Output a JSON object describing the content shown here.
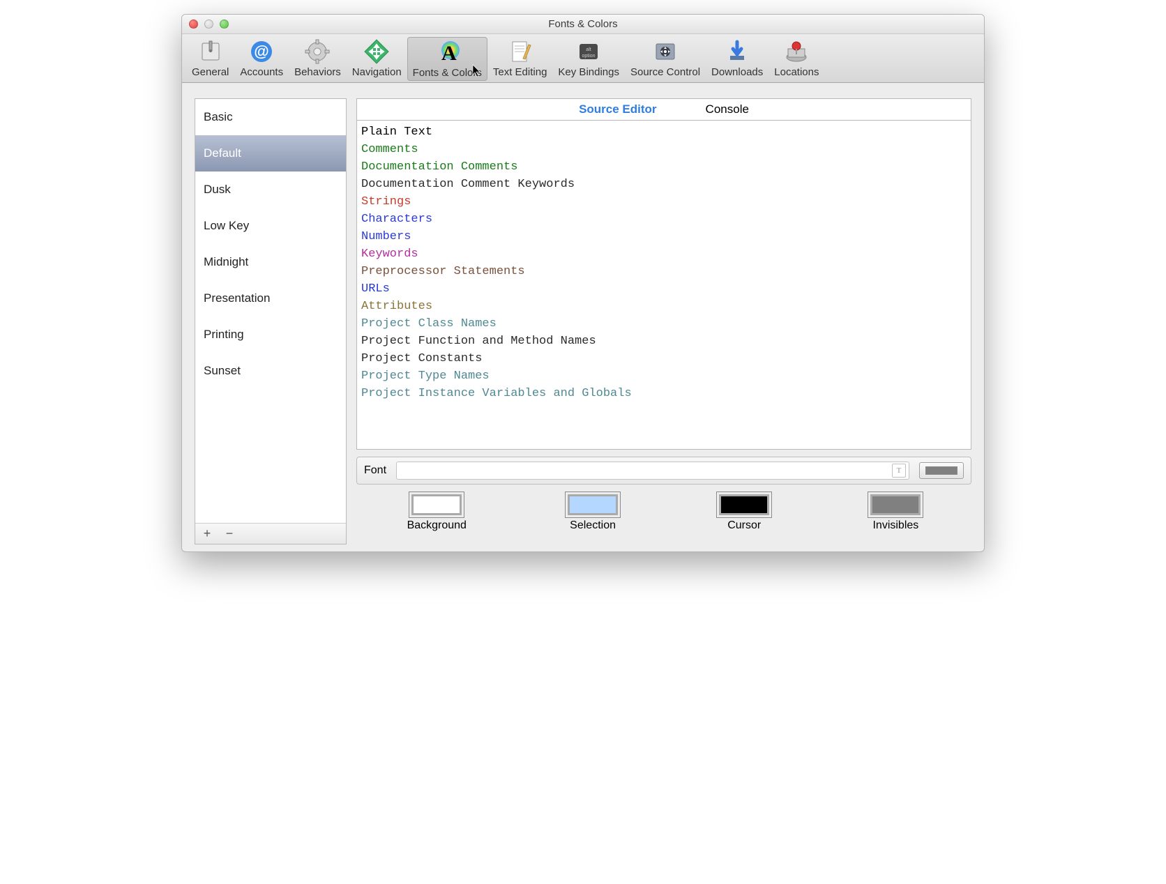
{
  "window": {
    "title": "Fonts & Colors"
  },
  "toolbar": {
    "items": [
      {
        "label": "General"
      },
      {
        "label": "Accounts"
      },
      {
        "label": "Behaviors"
      },
      {
        "label": "Navigation"
      },
      {
        "label": "Fonts & Colors"
      },
      {
        "label": "Text Editing"
      },
      {
        "label": "Key Bindings"
      },
      {
        "label": "Source Control"
      },
      {
        "label": "Downloads"
      },
      {
        "label": "Locations"
      }
    ],
    "selected": "Fonts & Colors"
  },
  "themes": {
    "items": [
      "Basic",
      "Default",
      "Dusk",
      "Low Key",
      "Midnight",
      "Presentation",
      "Printing",
      "Sunset"
    ],
    "selected": "Default"
  },
  "tabs": {
    "items": [
      "Source Editor",
      "Console"
    ],
    "active": "Source Editor"
  },
  "syntax": [
    {
      "label": "Plain Text",
      "color": "#000000"
    },
    {
      "label": "Comments",
      "color": "#1a7c1a"
    },
    {
      "label": "Documentation Comments",
      "color": "#1a7c1a"
    },
    {
      "label": "Documentation Comment Keywords",
      "color": "#2b2b2b"
    },
    {
      "label": "Strings",
      "color": "#c83a2a"
    },
    {
      "label": "Characters",
      "color": "#2a3ad8"
    },
    {
      "label": "Numbers",
      "color": "#2a3ad8"
    },
    {
      "label": "Keywords",
      "color": "#b42fa0"
    },
    {
      "label": "Preprocessor Statements",
      "color": "#7a513c"
    },
    {
      "label": "URLs",
      "color": "#2238d6"
    },
    {
      "label": "Attributes",
      "color": "#8a7438"
    },
    {
      "label": "Project Class Names",
      "color": "#4f8893"
    },
    {
      "label": "Project Function and Method Names",
      "color": "#2b2b2b"
    },
    {
      "label": "Project Constants",
      "color": "#2b2b2b"
    },
    {
      "label": "Project Type Names",
      "color": "#4f8893"
    },
    {
      "label": "Project Instance Variables and Globals",
      "color": "#4f8893"
    }
  ],
  "font": {
    "label": "Font",
    "value": ""
  },
  "wells": {
    "items": [
      {
        "label": "Background",
        "color": "#ffffff"
      },
      {
        "label": "Selection",
        "color": "#b3d7ff"
      },
      {
        "label": "Cursor",
        "color": "#000000"
      },
      {
        "label": "Invisibles",
        "color": "#808080"
      }
    ],
    "font_swatch": "#808080"
  }
}
